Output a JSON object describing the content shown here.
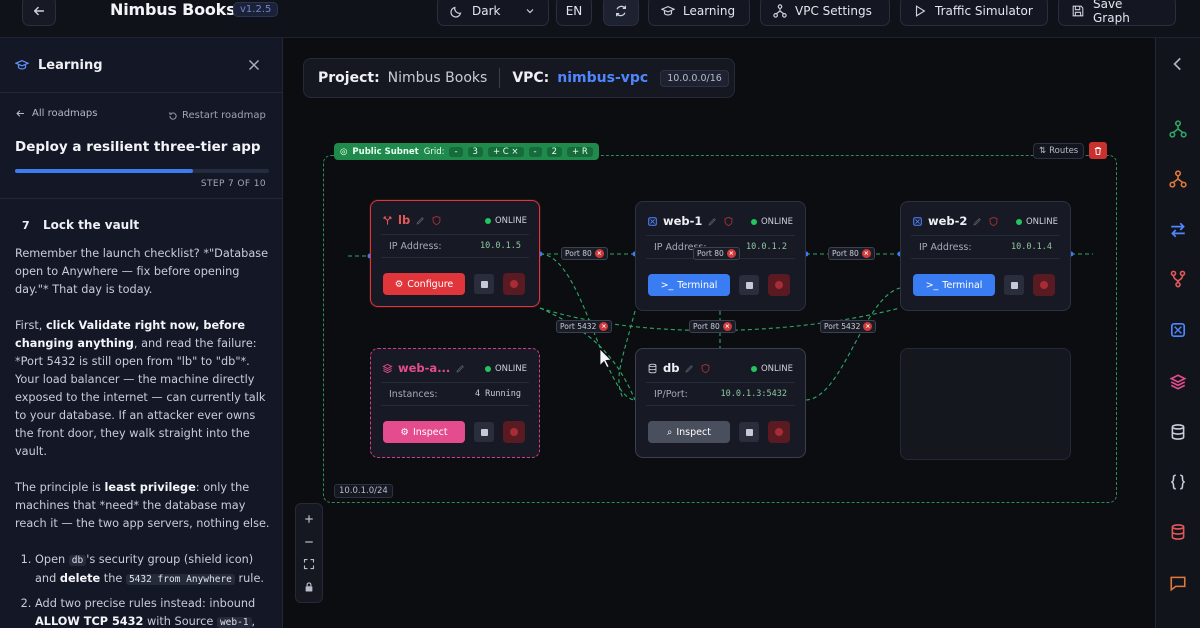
{
  "app": {
    "title": "Nimbus Books",
    "version": "v1.2.5"
  },
  "toolbar": {
    "theme": "Dark",
    "language": "EN",
    "learning": "Learning",
    "vpc_settings": "VPC Settings",
    "traffic_simulator": "Traffic Simulator",
    "save_graph": "Save Graph"
  },
  "learning_panel": {
    "title": "Learning",
    "all_roadmaps": "All roadmaps",
    "restart": "Restart roadmap",
    "roadmap_title": "Deploy a resilient three-tier app",
    "progress_fraction": 0.7,
    "step_label": "STEP 7 OF 10",
    "step_number": "7",
    "step_title": "Lock the vault",
    "p1": "Remember the launch checklist? *\"Database open to Anywhere — fix before opening day.\"* That day is today.",
    "p2_a": "First, ",
    "p2_b": "click Validate right now, before changing anything",
    "p2_c": ", and read the failure: *Port 5432 is still open from \"lb\" to \"db\"*. Your load balancer — the machine directly exposed to the internet — can currently talk to your database. If an attacker ever owns the front door, they walk straight into the vault.",
    "p3_a": "The principle is ",
    "p3_b": "least privilege",
    "p3_c": ": only the machines that *need* the database may reach it — the two app servers, nothing else.",
    "li1_a": "Open ",
    "li1_code1": "db",
    "li1_b": "'s security group (shield icon) and ",
    "li1_c": "delete",
    "li1_d": " the ",
    "li1_code2": "5432 from Anywhere",
    "li1_e": " rule.",
    "li2_a": "Add two precise rules instead: inbound ",
    "li2_b": "ALLOW TCP 5432",
    "li2_c": " with Source ",
    "li2_code": "web-1",
    "li2_d": ", and"
  },
  "canvas": {
    "project_label": "Project:",
    "project_name": "Nimbus Books",
    "vpc_label": "VPC:",
    "vpc_name": "nimbus-vpc",
    "vpc_cidr": "10.0.0.0/16",
    "subnet": {
      "name": "Public Subnet",
      "grid_label": "Grid:",
      "minus1": "-",
      "cols": "3",
      "plus1": "+ C ×",
      "minus2": "-",
      "rows": "2",
      "plus2": "+ R",
      "routes": "Routes",
      "cidr": "10.0.1.0/24"
    },
    "nodes": {
      "lb": {
        "name": "lb",
        "status": "ONLINE",
        "field": "IP Address:",
        "value": "10.0.1.5",
        "action": "Configure"
      },
      "web1": {
        "name": "web-1",
        "status": "ONLINE",
        "field": "IP Address:",
        "value": "10.0.1.2",
        "action": "Terminal"
      },
      "web2": {
        "name": "web-2",
        "status": "ONLINE",
        "field": "IP Address:",
        "value": "10.0.1.4",
        "action": "Terminal"
      },
      "weba": {
        "name": "web-a...",
        "status": "ONLINE",
        "field": "Instances:",
        "value": "4 Running",
        "action": "Inspect"
      },
      "db": {
        "name": "db",
        "status": "ONLINE",
        "field": "IP/Port:",
        "value": "10.0.1.3:5432",
        "action": "Inspect"
      }
    },
    "edges": {
      "e1": "Port 80",
      "e2": "Port 80",
      "e3": "Port 80",
      "e4": "Port 5432",
      "e5": "Port 80",
      "e6": "Port 5432"
    }
  },
  "colors": {
    "accent": "#3a7df2",
    "danger": "#e0353a",
    "success": "#22c55e",
    "pink": "#e44c8e",
    "subnet": "#1f8a4c"
  }
}
